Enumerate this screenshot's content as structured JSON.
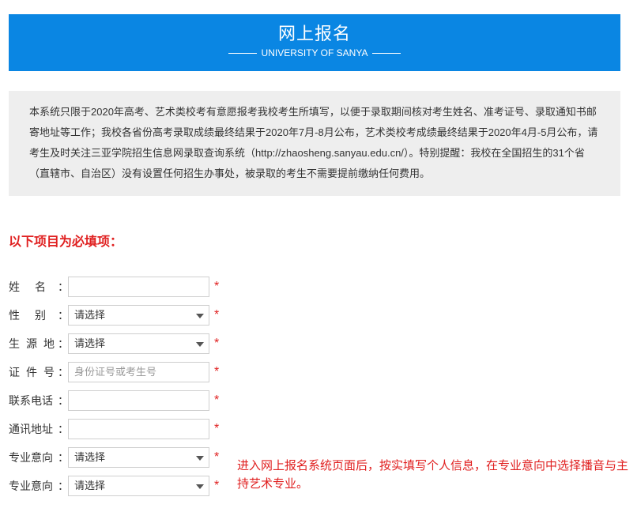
{
  "banner": {
    "title": "网上报名",
    "subtitle": "UNIVERSITY OF SANYA"
  },
  "notice": {
    "text": "本系统只限于2020年高考、艺术类校考有意愿报考我校考生所填写，以便于录取期间核对考生姓名、准考证号、录取通知书邮寄地址等工作；我校各省份高考录取成绩最终结果于2020年7月-8月公布，艺术类校考成绩最终结果于2020年4月-5月公布，请考生及时关注三亚学院招生信息网录取查询系统（http://zhaosheng.sanyau.edu.cn/）。特别提醒：我校在全国招生的31个省（直辖市、自治区）没有设置任何招生办事处，被录取的考生不需要提前缴纳任何费用。"
  },
  "form": {
    "required_heading": "以下项目为必填项：",
    "required_mark": "*",
    "colon": "：",
    "fields": {
      "name": {
        "label": "姓名",
        "value": ""
      },
      "gender": {
        "label": "性别",
        "value": "请选择"
      },
      "origin": {
        "label": "生源地",
        "value": "请选择"
      },
      "id_number": {
        "label": "证件号",
        "value": "",
        "placeholder": "身份证号或考生号"
      },
      "phone": {
        "label": "联系电话",
        "value": ""
      },
      "address": {
        "label": "通讯地址",
        "value": ""
      },
      "major1": {
        "label": "专业意向",
        "value": "请选择"
      },
      "major2": {
        "label": "专业意向",
        "value": "请选择"
      }
    }
  },
  "annotation": {
    "text": "进入网上报名系统页面后，按实填写个人信息，在专业意向中选择播音与主持艺术专业。"
  },
  "colors": {
    "banner": "#0a86e3",
    "notice_bg": "#eeeeee",
    "required": "#e02020"
  }
}
